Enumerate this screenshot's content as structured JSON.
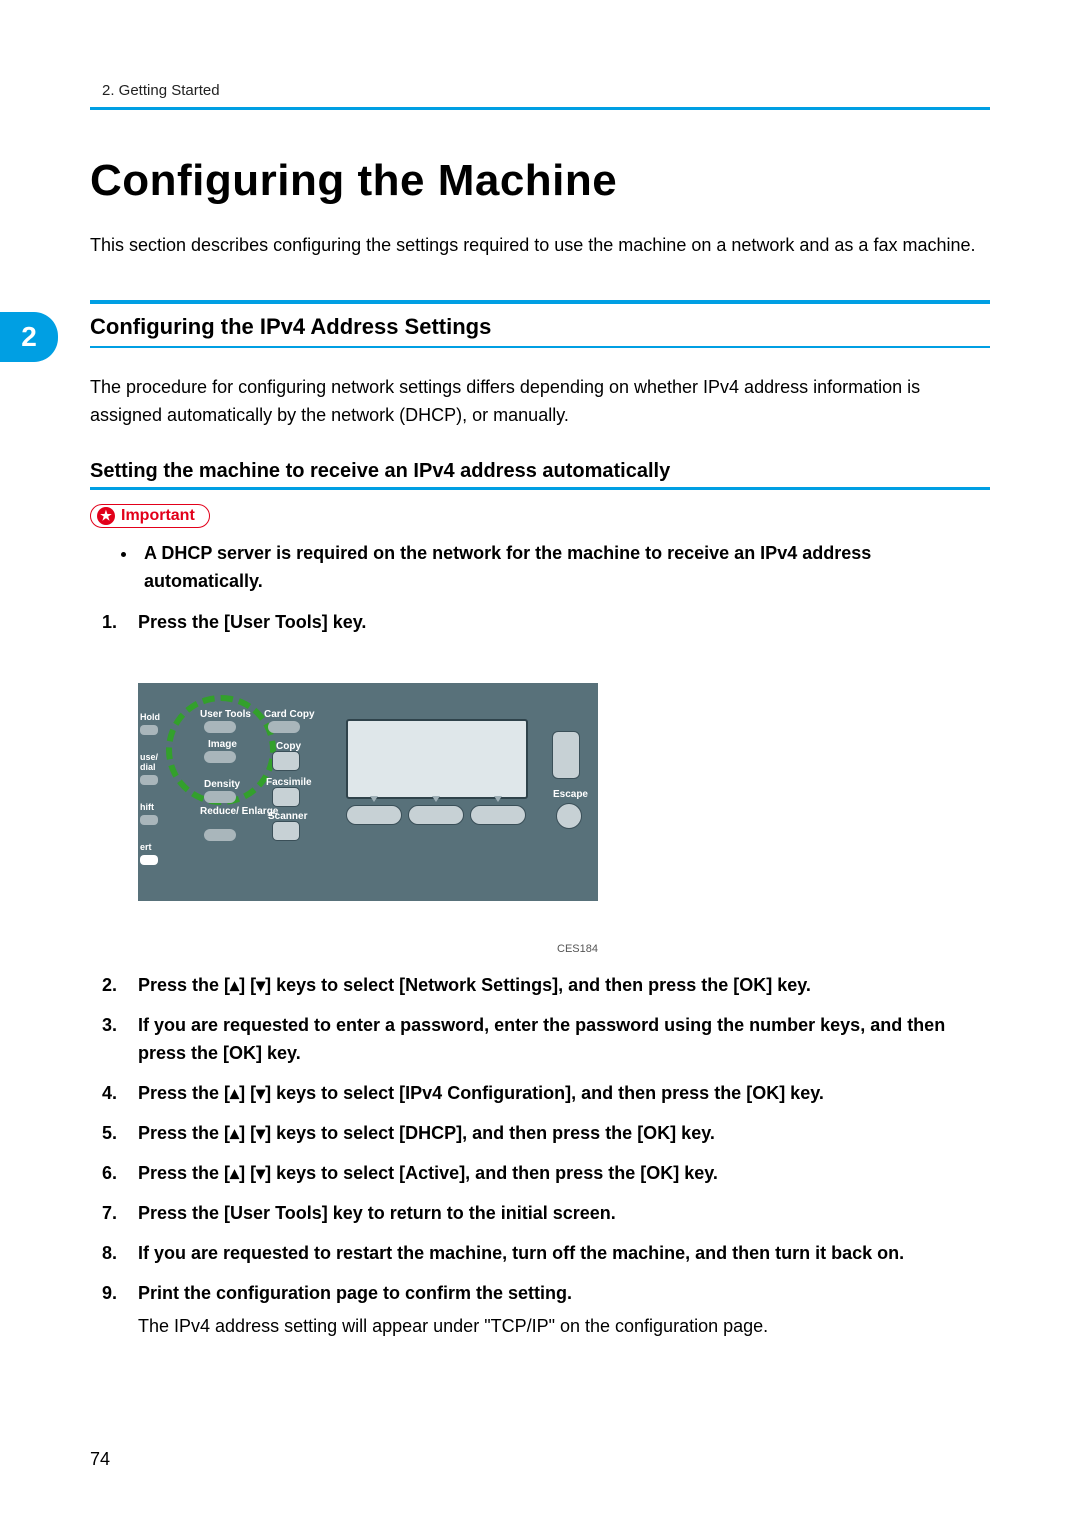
{
  "running_head": "2. Getting Started",
  "chapter_tab": "2",
  "title": "Configuring the Machine",
  "intro": "This section describes configuring the settings required to use the machine on a network and as a fax machine.",
  "h2": "Configuring the IPv4 Address Settings",
  "h2_body": "The procedure for configuring network settings differs depending on whether IPv4 address information is assigned automatically by the network (DHCP), or manually.",
  "h3": "Setting the machine to receive an IPv4 address automatically",
  "important_label": "Important",
  "important_bullet": "A DHCP server is required on the network for the machine to receive an IPv4 address automatically.",
  "panel_labels": {
    "user_tools": "User Tools",
    "image": "Image",
    "card_copy": "Card Copy",
    "copy": "Copy",
    "facsimile": "Facsimile",
    "scanner": "Scanner",
    "density": "Density",
    "reduce_enlarge": "Reduce/\nEnlarge",
    "escape": "Escape",
    "left_hold": "Hold",
    "left_dial": "use/\ndial",
    "left_shift": "hift",
    "left_ert": "ert"
  },
  "illustration_code": "CES184",
  "steps": [
    "Press the [User Tools] key.",
    "Press the [▴] [▾] keys to select [Network Settings], and then press the [OK] key.",
    "If you are requested to enter a password, enter the password using the number keys, and then press the [OK] key.",
    "Press the [▴] [▾] keys to select [IPv4 Configuration], and then press the [OK] key.",
    "Press the [▴] [▾] keys to select [DHCP], and then press the [OK] key.",
    "Press the [▴] [▾] keys to select [Active], and then press the [OK] key.",
    "Press the [User Tools] key to return to the initial screen.",
    "If you are requested to restart the machine, turn off the machine, and then turn it back on.",
    "Print the configuration page to confirm the setting."
  ],
  "step9_sub": "The IPv4 address setting will appear under \"TCP/IP\" on the configuration page.",
  "page_number": "74"
}
